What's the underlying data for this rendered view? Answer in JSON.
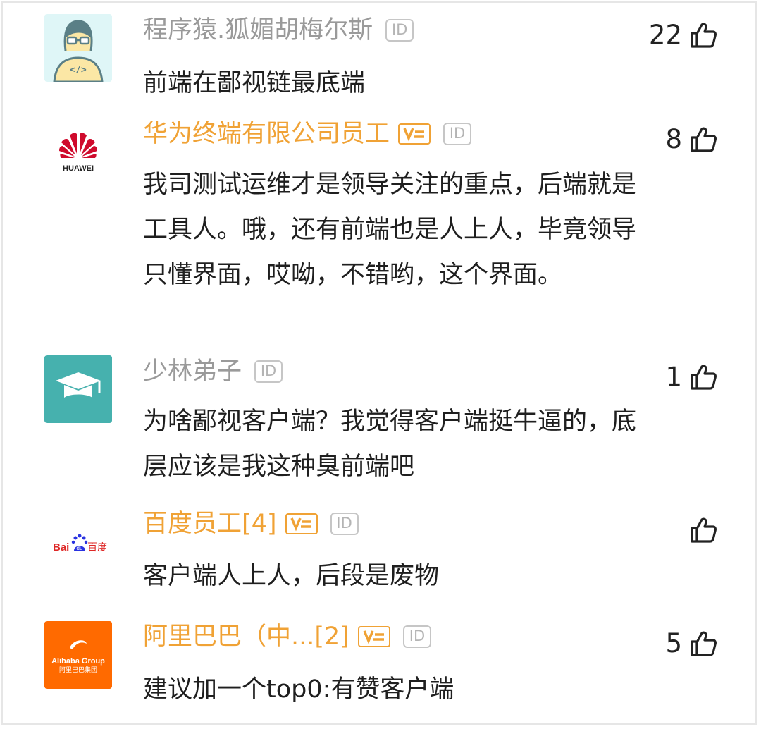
{
  "comments": [
    {
      "username": "程序猿.狐媚胡梅尔斯",
      "verified": false,
      "id_badge": "ID",
      "likes": "22",
      "text": "前端在鄙视链最底端",
      "avatar": "programmer-avatar"
    },
    {
      "username": "华为终端有限公司员工",
      "verified": true,
      "id_badge": "ID",
      "likes": "8",
      "text": "我司测试运维才是领导关注的重点，后端就是工具人。哦，还有前端也是人上人，毕竟领导只懂界面，哎呦，不错哟，这个界面。",
      "avatar_text": "HUAWEI"
    },
    {
      "username": "少林弟子",
      "verified": false,
      "id_badge": "ID",
      "likes": "1",
      "text": "为啥鄙视客户端？我觉得客户端挺牛逼的，底层应该是我这种臭前端吧",
      "avatar": "graduation-cap-avatar"
    },
    {
      "username": "百度员工[4]",
      "verified": true,
      "id_badge": "ID",
      "likes": "",
      "text": "客户端人上人，后段是废物",
      "avatar_text_left": "Bai",
      "avatar_text_right": "百度"
    },
    {
      "username": "阿里巴巴（中...[2]",
      "verified": true,
      "id_badge": "ID",
      "likes": "5",
      "text": "建议加一个top0:有赞客户端",
      "avatar_text_top": "Alibaba Group",
      "avatar_text_bottom": "阿里巴巴集团"
    }
  ],
  "colors": {
    "username_gray": "#9a9a9a",
    "username_orange": "#f0a235",
    "text": "#1f1f1f",
    "avatar_teal": "#46b1ae",
    "avatar_alibaba": "#ff6a00",
    "huawei_red": "#cf0a2c"
  },
  "icons": [
    "thumbs-up-icon",
    "verified-v-icon",
    "id-badge-icon"
  ]
}
